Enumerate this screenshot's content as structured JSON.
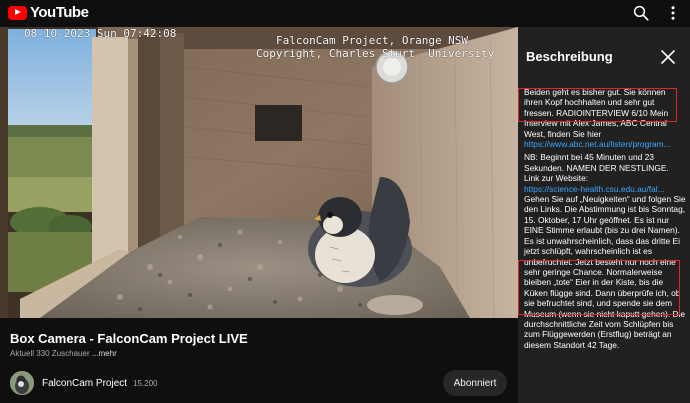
{
  "app": {
    "logo_text": "YouTube",
    "icons": [
      "search-icon",
      "more-vert-icon",
      "close-icon"
    ],
    "accent_color": "#ff0000",
    "highlight_color": "#e0262b",
    "link_color": "#3ea6ff"
  },
  "video": {
    "timestamp": "08-10-2023 Sun 07:42:08",
    "credit_line_1": "FalconCam Project, Orange NSW",
    "credit_line_2": "Copyright, Charles Sturt  University"
  },
  "info": {
    "title": "Box Camera - FalconCam Project LIVE",
    "viewers": "Aktuell 330 Zuschauer",
    "more_label": "...mehr",
    "channel_name": "FalconCam Project",
    "subscriber_count": "15.200",
    "subscribe_label": "Abonniert"
  },
  "panel": {
    "title": "Beschreibung",
    "p1": "Beiden geht es bisher gut. Sie können ihren Kopf hochhalten und sehr gut fressen. RADIOINTERVIEW 6/10 Mein Interview mit Alex James, ABC Central West, finden Sie hier",
    "link1": "https://www.abc.net.au/listen/program...",
    "p2": "NB: Beginnt bei 45 Minuten und 23 Sekunden. NAMEN DER NESTLINGE. Link zur Website:",
    "link2": "https://science-health.csu.edu.au/fal...",
    "p3": " Gehen Sie auf „Neuigkeiten“ und folgen Sie den Links. Die Abstimmung ist bis Sonntag, 15. Oktober, 17 Uhr geöffnet. Es ist nur EINE Stimme erlaubt (bis zu drei Namen). Es ist unwahrscheinlich, dass das dritte Ei jetzt schlüpft, wahrscheinlich ist es unbefruchtet. Jetzt besteht nur noch eine sehr geringe Chance. Normalerweise bleiben „tote“ Eier in der Kiste, bis die Küken flügge sind. Dann überprüfe ich, ob sie befruchtet sind, und spende sie dem Museum (wenn sie nicht kaputt gehen). Die durchschnittliche Zeit vom Schlüpfen bis zum Flüggewerden (Erstflug) beträgt an diesem Standort 42 Tage."
  }
}
